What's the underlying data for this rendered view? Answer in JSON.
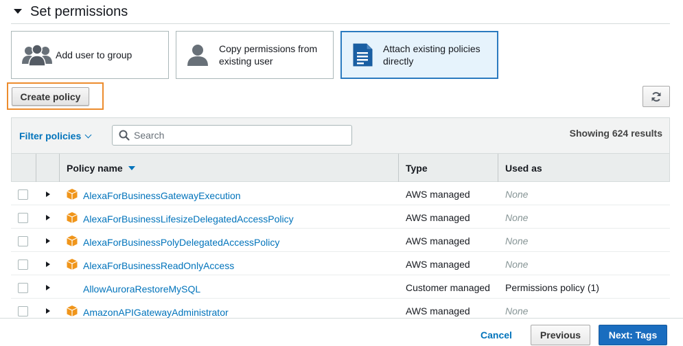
{
  "section": {
    "title": "Set permissions"
  },
  "permission_options": [
    {
      "label": "Add user to group",
      "icon": "group-icon",
      "selected": false
    },
    {
      "label": "Copy permissions from existing user",
      "icon": "user-icon",
      "selected": false
    },
    {
      "label": "Attach existing policies directly",
      "icon": "document-icon",
      "selected": true
    }
  ],
  "toolbar": {
    "create_policy_label": "Create policy",
    "refresh_icon": "refresh-icon"
  },
  "filter": {
    "filter_label": "Filter policies",
    "search_placeholder": "Search",
    "results_text": "Showing 624 results"
  },
  "table": {
    "columns": {
      "name": "Policy name",
      "type": "Type",
      "used_as": "Used as"
    },
    "rows": [
      {
        "name": "AlexaForBusinessGatewayExecution",
        "type": "AWS managed",
        "used_as": "None",
        "icon": "package-icon"
      },
      {
        "name": "AlexaForBusinessLifesizeDelegatedAccessPolicy",
        "type": "AWS managed",
        "used_as": "None",
        "icon": "package-icon"
      },
      {
        "name": "AlexaForBusinessPolyDelegatedAccessPolicy",
        "type": "AWS managed",
        "used_as": "None",
        "icon": "package-icon"
      },
      {
        "name": "AlexaForBusinessReadOnlyAccess",
        "type": "AWS managed",
        "used_as": "None",
        "icon": "package-icon"
      },
      {
        "name": "AllowAuroraRestoreMySQL",
        "type": "Customer managed",
        "used_as": "Permissions policy (1)",
        "icon": ""
      },
      {
        "name": "AmazonAPIGatewayAdministrator",
        "type": "AWS managed",
        "used_as": "None",
        "icon": "package-icon"
      }
    ]
  },
  "footer": {
    "cancel_label": "Cancel",
    "previous_label": "Previous",
    "next_label": "Next: Tags"
  },
  "colors": {
    "accent": "#0073bb",
    "primary_button": "#1a6dbf",
    "highlight_outline": "#ec8b2d",
    "package_orange": "#f0951a"
  }
}
